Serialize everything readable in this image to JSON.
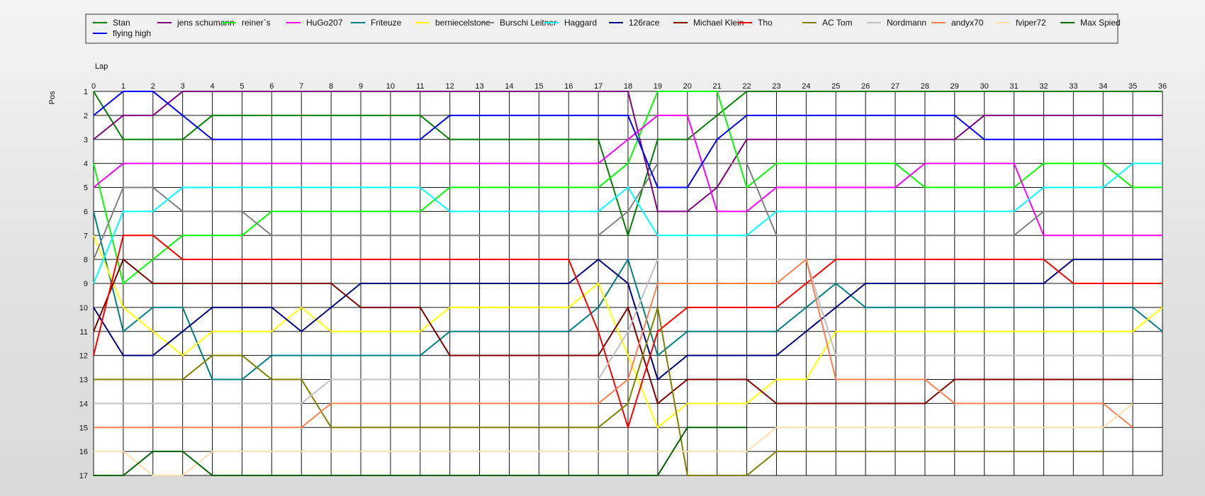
{
  "chart_data": {
    "type": "line",
    "xlabel": "Lap",
    "ylabel": "Pos",
    "xlim": [
      0,
      36
    ],
    "ylim": [
      1,
      17
    ],
    "y_inverted": true,
    "grid": true,
    "legend_position": "top",
    "x": [
      0,
      1,
      2,
      3,
      4,
      5,
      6,
      7,
      8,
      9,
      10,
      11,
      12,
      13,
      14,
      15,
      16,
      17,
      18,
      19,
      20,
      21,
      22,
      23,
      24,
      25,
      26,
      27,
      28,
      29,
      30,
      31,
      32,
      33,
      34,
      35,
      36
    ],
    "y_ticks": [
      1,
      2,
      3,
      4,
      5,
      6,
      7,
      8,
      9,
      10,
      11,
      12,
      13,
      14,
      15,
      16,
      17
    ],
    "series": [
      {
        "name": "Stan",
        "color": "#008000",
        "values": [
          1,
          3,
          3,
          3,
          2,
          2,
          2,
          2,
          2,
          2,
          2,
          2,
          3,
          3,
          3,
          3,
          3,
          3,
          7,
          3,
          3,
          2,
          1,
          1,
          1,
          1,
          1,
          1,
          1,
          1,
          1,
          1,
          1,
          1,
          1,
          1,
          1
        ]
      },
      {
        "name": "jens  schumann",
        "color": "#800080",
        "values": [
          3,
          2,
          2,
          1,
          1,
          1,
          1,
          1,
          1,
          1,
          1,
          1,
          1,
          1,
          1,
          1,
          1,
          1,
          1,
          6,
          6,
          5,
          3,
          3,
          3,
          3,
          3,
          3,
          3,
          3,
          2,
          2,
          2,
          2,
          2,
          2,
          2
        ]
      },
      {
        "name": "reiner`s",
        "color": "#00ff00",
        "values": [
          4,
          9,
          8,
          7,
          7,
          7,
          6,
          6,
          6,
          6,
          6,
          6,
          5,
          5,
          5,
          5,
          5,
          5,
          4,
          1,
          1,
          1,
          5,
          4,
          4,
          4,
          4,
          4,
          5,
          5,
          5,
          5,
          4,
          4,
          4,
          5,
          5
        ]
      },
      {
        "name": "HuGo207",
        "color": "#ff00ff",
        "values": [
          5,
          4,
          4,
          4,
          4,
          4,
          4,
          4,
          4,
          4,
          4,
          4,
          4,
          4,
          4,
          4,
          4,
          4,
          3,
          2,
          2,
          6,
          6,
          5,
          5,
          5,
          5,
          5,
          4,
          4,
          4,
          4,
          7,
          7,
          7,
          7,
          7
        ]
      },
      {
        "name": "Friteuze",
        "color": "#008080",
        "values": [
          6,
          11,
          10,
          10,
          13,
          13,
          12,
          12,
          12,
          12,
          12,
          12,
          11,
          11,
          11,
          11,
          11,
          10,
          8,
          12,
          11,
          11,
          11,
          11,
          10,
          9,
          10,
          10,
          10,
          10,
          10,
          10,
          10,
          10,
          10,
          10,
          11
        ]
      },
      {
        "name": "berniecelstone",
        "color": "#ffff00",
        "values": [
          7,
          10,
          11,
          12,
          11,
          11,
          11,
          10,
          11,
          11,
          11,
          11,
          10,
          10,
          10,
          10,
          10,
          9,
          12,
          15,
          14,
          14,
          14,
          13,
          13,
          11,
          11,
          11,
          11,
          11,
          11,
          11,
          11,
          11,
          11,
          11,
          10
        ]
      },
      {
        "name": "Burschi Leitner",
        "color": "#808080",
        "values": [
          8,
          5,
          5,
          6,
          6,
          6,
          7,
          7,
          7,
          7,
          7,
          7,
          7,
          7,
          7,
          7,
          7,
          7,
          6,
          4,
          4,
          4,
          4,
          7,
          7,
          7,
          7,
          7,
          7,
          7,
          7,
          7,
          6,
          6,
          6,
          6,
          6
        ]
      },
      {
        "name": "Haggard",
        "color": "#00ffff",
        "values": [
          9,
          6,
          6,
          5,
          5,
          5,
          5,
          5,
          5,
          5,
          5,
          5,
          6,
          6,
          6,
          6,
          6,
          6,
          5,
          7,
          7,
          7,
          7,
          6,
          6,
          6,
          6,
          6,
          6,
          6,
          6,
          6,
          5,
          5,
          5,
          4,
          4
        ]
      },
      {
        "name": "126race",
        "color": "#000080",
        "values": [
          10,
          12,
          12,
          11,
          10,
          10,
          10,
          11,
          10,
          9,
          9,
          9,
          9,
          9,
          9,
          9,
          9,
          8,
          9,
          13,
          12,
          12,
          12,
          12,
          11,
          10,
          9,
          9,
          9,
          9,
          9,
          9,
          9,
          8,
          8,
          8,
          8
        ]
      },
      {
        "name": "Michael Klein",
        "color": "#800000",
        "values": [
          11,
          8,
          9,
          9,
          9,
          9,
          9,
          9,
          9,
          10,
          10,
          10,
          12,
          12,
          12,
          12,
          12,
          12,
          10,
          14,
          13,
          13,
          13,
          14,
          14,
          14,
          14,
          14,
          14,
          13,
          13,
          13,
          13,
          13,
          13,
          13,
          null
        ]
      },
      {
        "name": "Tho",
        "color": "#ff0000",
        "values": [
          12,
          7,
          7,
          8,
          8,
          8,
          8,
          8,
          8,
          8,
          8,
          8,
          8,
          8,
          8,
          8,
          8,
          11,
          15,
          11,
          10,
          10,
          10,
          10,
          9,
          8,
          8,
          8,
          8,
          8,
          8,
          8,
          8,
          9,
          9,
          9,
          9
        ]
      },
      {
        "name": "AC Tom",
        "color": "#808000",
        "values": [
          13,
          13,
          13,
          13,
          12,
          12,
          13,
          13,
          15,
          15,
          15,
          15,
          15,
          15,
          15,
          15,
          15,
          15,
          14,
          10,
          17,
          17,
          17,
          16,
          16,
          16,
          16,
          16,
          16,
          16,
          16,
          16,
          16,
          16,
          16,
          null,
          null
        ]
      },
      {
        "name": "Nordmann",
        "color": "#c0c0c0",
        "values": [
          14,
          14,
          14,
          14,
          14,
          14,
          14,
          14,
          13,
          13,
          13,
          13,
          13,
          13,
          13,
          13,
          13,
          13,
          11,
          8,
          8,
          8,
          8,
          8,
          8,
          12,
          12,
          12,
          12,
          12,
          12,
          12,
          12,
          12,
          12,
          12,
          12
        ]
      },
      {
        "name": "andyx70",
        "color": "#ff7f50",
        "values": [
          15,
          15,
          15,
          15,
          15,
          15,
          15,
          15,
          14,
          14,
          14,
          14,
          14,
          14,
          14,
          14,
          14,
          14,
          13,
          9,
          9,
          9,
          9,
          9,
          8,
          13,
          13,
          13,
          13,
          14,
          14,
          14,
          14,
          14,
          14,
          15,
          null
        ]
      },
      {
        "name": "fviper72",
        "color": "#ffdead",
        "values": [
          16,
          16,
          17,
          17,
          16,
          16,
          16,
          16,
          16,
          16,
          16,
          16,
          16,
          16,
          16,
          16,
          16,
          16,
          16,
          16,
          16,
          16,
          16,
          15,
          15,
          15,
          15,
          15,
          15,
          15,
          15,
          15,
          15,
          15,
          15,
          14,
          null
        ]
      },
      {
        "name": "Max Spied",
        "color": "#006400",
        "values": [
          17,
          17,
          16,
          16,
          17,
          17,
          17,
          17,
          17,
          17,
          17,
          17,
          17,
          17,
          17,
          17,
          17,
          17,
          17,
          17,
          15,
          15,
          15,
          null,
          null,
          null,
          null,
          null,
          null,
          null,
          null,
          null,
          null,
          null,
          null,
          null,
          null
        ]
      },
      {
        "name": "flying high",
        "color": "#0000ff",
        "values": [
          2,
          1,
          1,
          2,
          3,
          3,
          3,
          3,
          3,
          3,
          3,
          3,
          2,
          2,
          2,
          2,
          2,
          2,
          2,
          5,
          5,
          3,
          2,
          2,
          2,
          2,
          2,
          2,
          2,
          2,
          3,
          3,
          3,
          3,
          3,
          3,
          3
        ]
      }
    ]
  }
}
